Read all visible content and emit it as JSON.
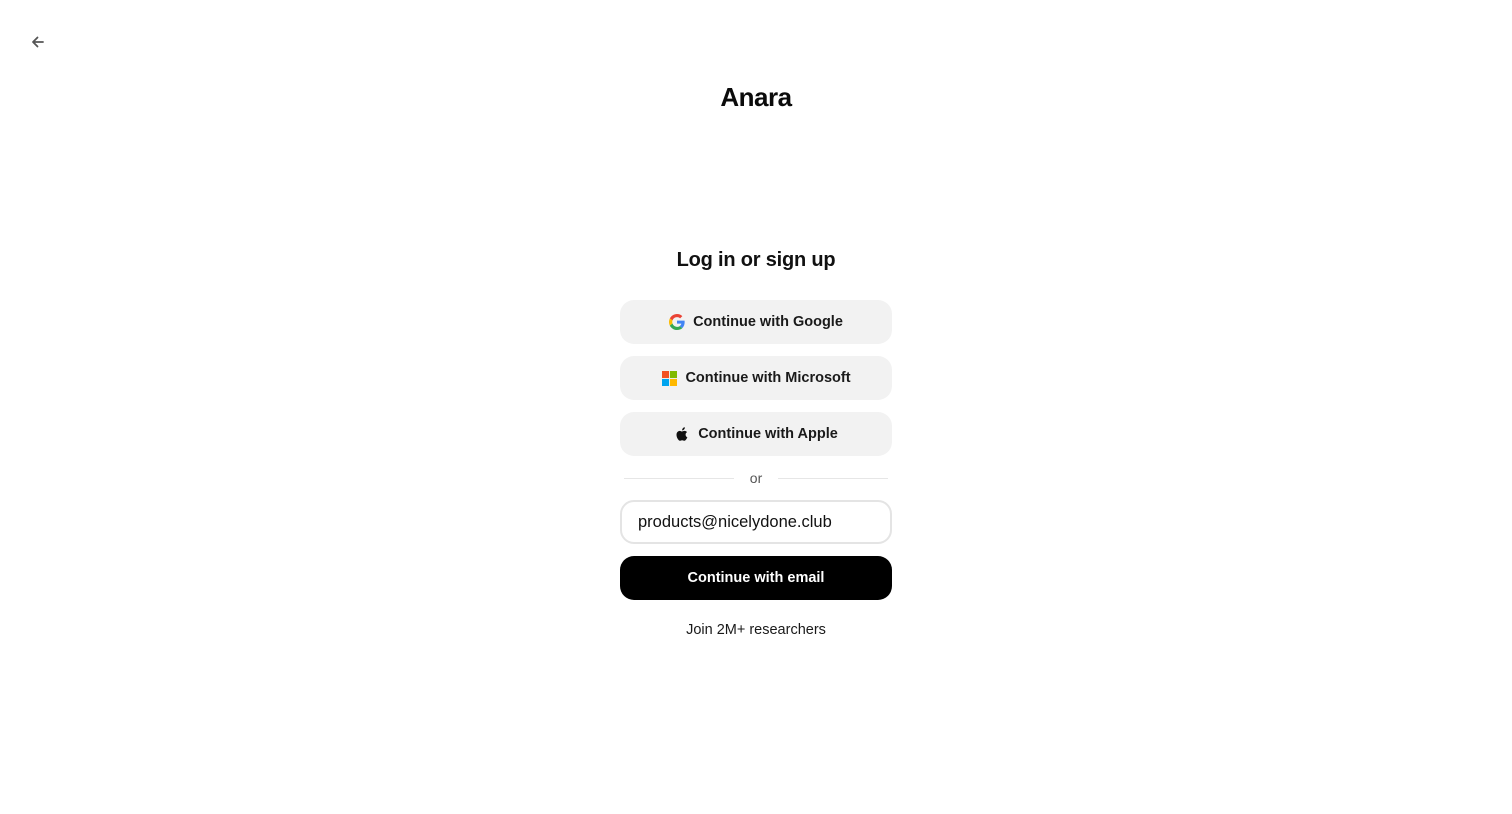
{
  "header": {
    "back_icon": "arrow-left-icon",
    "logo_text": "Anara"
  },
  "auth": {
    "title": "Log in or sign up",
    "google_label": "Continue with Google",
    "microsoft_label": "Continue with Microsoft",
    "apple_label": "Continue with Apple",
    "divider_text": "or",
    "email_value": "products@nicelydone.club",
    "email_button_label": "Continue with email",
    "footer_text": "Join 2M+ researchers"
  },
  "icons": {
    "google": "google-icon",
    "microsoft": "microsoft-icon",
    "apple": "apple-icon"
  },
  "colors": {
    "primary_button": "#000000",
    "social_button": "#f2f2f2",
    "input_border": "#e4e4e4",
    "google_blue": "#4285F4",
    "google_red": "#EA4335",
    "google_yellow": "#FBBC05",
    "google_green": "#34A853",
    "ms_red": "#F25022",
    "ms_green": "#7FBA00",
    "ms_blue": "#00A4EF",
    "ms_yellow": "#FFB900"
  }
}
